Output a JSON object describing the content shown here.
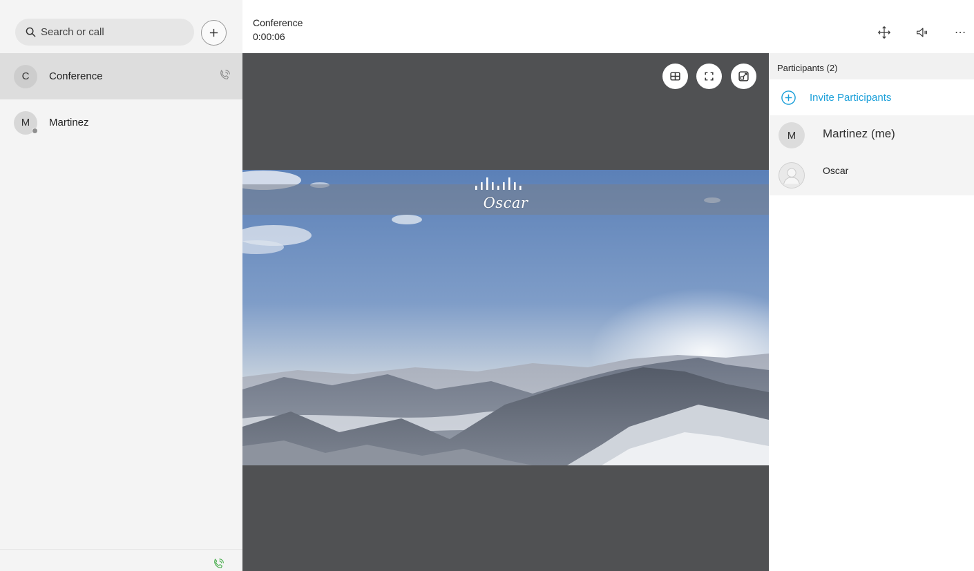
{
  "sidebar": {
    "search": {
      "placeholder": "Search or call",
      "value": ""
    },
    "add_button": "+",
    "conversations": [
      {
        "initial": "C",
        "name": "Conference",
        "active": true,
        "icon": "phone-icon"
      },
      {
        "initial": "M",
        "name": "Martinez",
        "active": false,
        "presence": "offline"
      }
    ],
    "footer_icon": "phone-icon"
  },
  "topbar": {
    "title": "Conference",
    "timer": "0:00:06",
    "icons": [
      "move-icon",
      "speaker-icon",
      "more-icon"
    ]
  },
  "stage": {
    "controls": [
      "grid-layout-icon",
      "fullscreen-icon",
      "popout-icon"
    ],
    "video_label": "Oscar"
  },
  "participants": {
    "header": "Participants (2)",
    "invite_label": "Invite Participants",
    "list": [
      {
        "initial": "M",
        "name": "Martinez (me)"
      },
      {
        "initial": "",
        "name": "Oscar",
        "avatar": "default-avatar-icon"
      }
    ]
  },
  "colors": {
    "accent": "#1a9fd9",
    "call_green": "#4caf50",
    "stage_bg": "#505153",
    "sidebar_bg": "#f4f4f4",
    "active_item": "#dddddd"
  }
}
